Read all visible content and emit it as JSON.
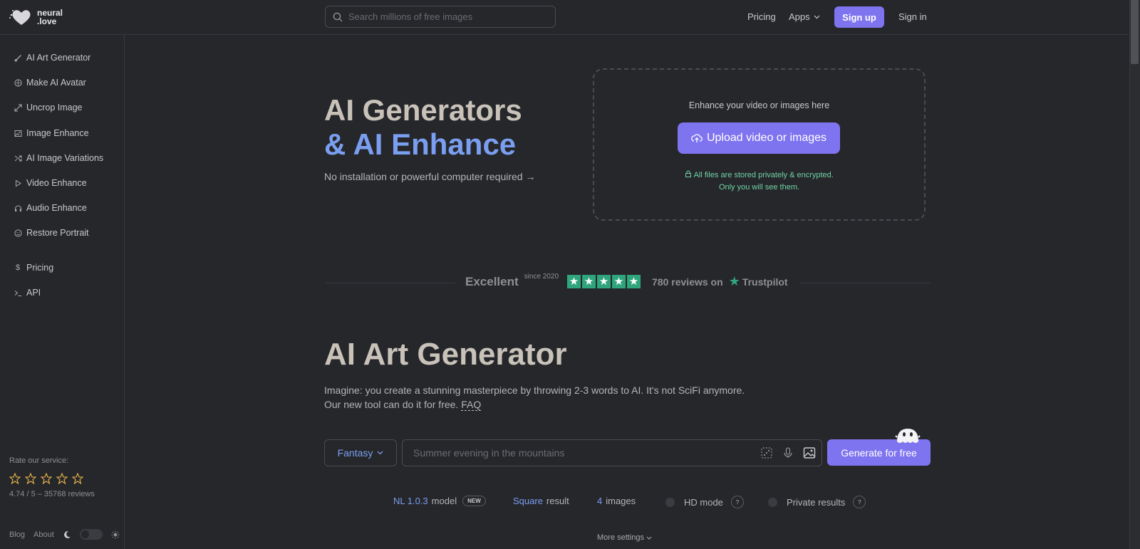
{
  "brand": {
    "line1": "neural",
    "line2": ".love"
  },
  "search": {
    "placeholder": "Search millions of free images"
  },
  "header": {
    "pricing": "Pricing",
    "apps": "Apps",
    "signup": "Sign up",
    "signin": "Sign in"
  },
  "sidebar": {
    "items": [
      {
        "label": "AI Art Generator",
        "icon": "brush-icon"
      },
      {
        "label": "Make AI Avatar",
        "icon": "avatar-icon"
      },
      {
        "label": "Uncrop Image",
        "icon": "expand-icon"
      },
      {
        "label": "Image Enhance",
        "icon": "image-icon"
      },
      {
        "label": "AI Image Variations",
        "icon": "shuffle-icon"
      },
      {
        "label": "Video Enhance",
        "icon": "play-icon"
      },
      {
        "label": "Audio Enhance",
        "icon": "headphones-icon"
      },
      {
        "label": "Restore Portrait",
        "icon": "face-icon"
      },
      {
        "label": "Pricing",
        "icon": "dollar-icon"
      },
      {
        "label": "API",
        "icon": "terminal-icon"
      }
    ],
    "rate_label": "Rate our service:",
    "rating_meta": "4.74 / 5 – 35768 reviews",
    "footer": {
      "blog": "Blog",
      "about": "About"
    }
  },
  "hero": {
    "title_line1": "AI Generators",
    "title_line2": "& AI Enhance",
    "subtitle": "No installation or powerful computer required",
    "upload_label": "Enhance your video or images here",
    "upload_button": "Upload video or images",
    "privacy_line1": "All files are stored privately & encrypted.",
    "privacy_line2": "Only you will see them."
  },
  "trust": {
    "excellent": "Excellent",
    "since": "since 2020",
    "reviews": "780 reviews on",
    "brand": "Trustpilot",
    "star_color": "#2fa57c"
  },
  "art": {
    "title": "AI Art Generator",
    "desc_line1": "Imagine: you create a stunning masterpiece by throwing 2-3 words to AI. It's not SciFi anymore.",
    "desc_line2_prefix": "Our new tool can do it for free.",
    "faq": "FAQ",
    "style": "Fantasy",
    "prompt_placeholder": "Summer evening in the mountains",
    "generate": "Generate for free"
  },
  "options": {
    "model_value": "NL 1.0.3",
    "model_suffix": "model",
    "new_badge": "NEW",
    "aspect_value": "Square",
    "aspect_suffix": "result",
    "count_value": "4",
    "count_suffix": "images",
    "hd": "HD mode",
    "private": "Private results",
    "help": "?",
    "more": "More settings"
  },
  "colors": {
    "accent": "#7f74f0",
    "link": "#7a9ef0",
    "privacy": "#6fd3a4"
  }
}
